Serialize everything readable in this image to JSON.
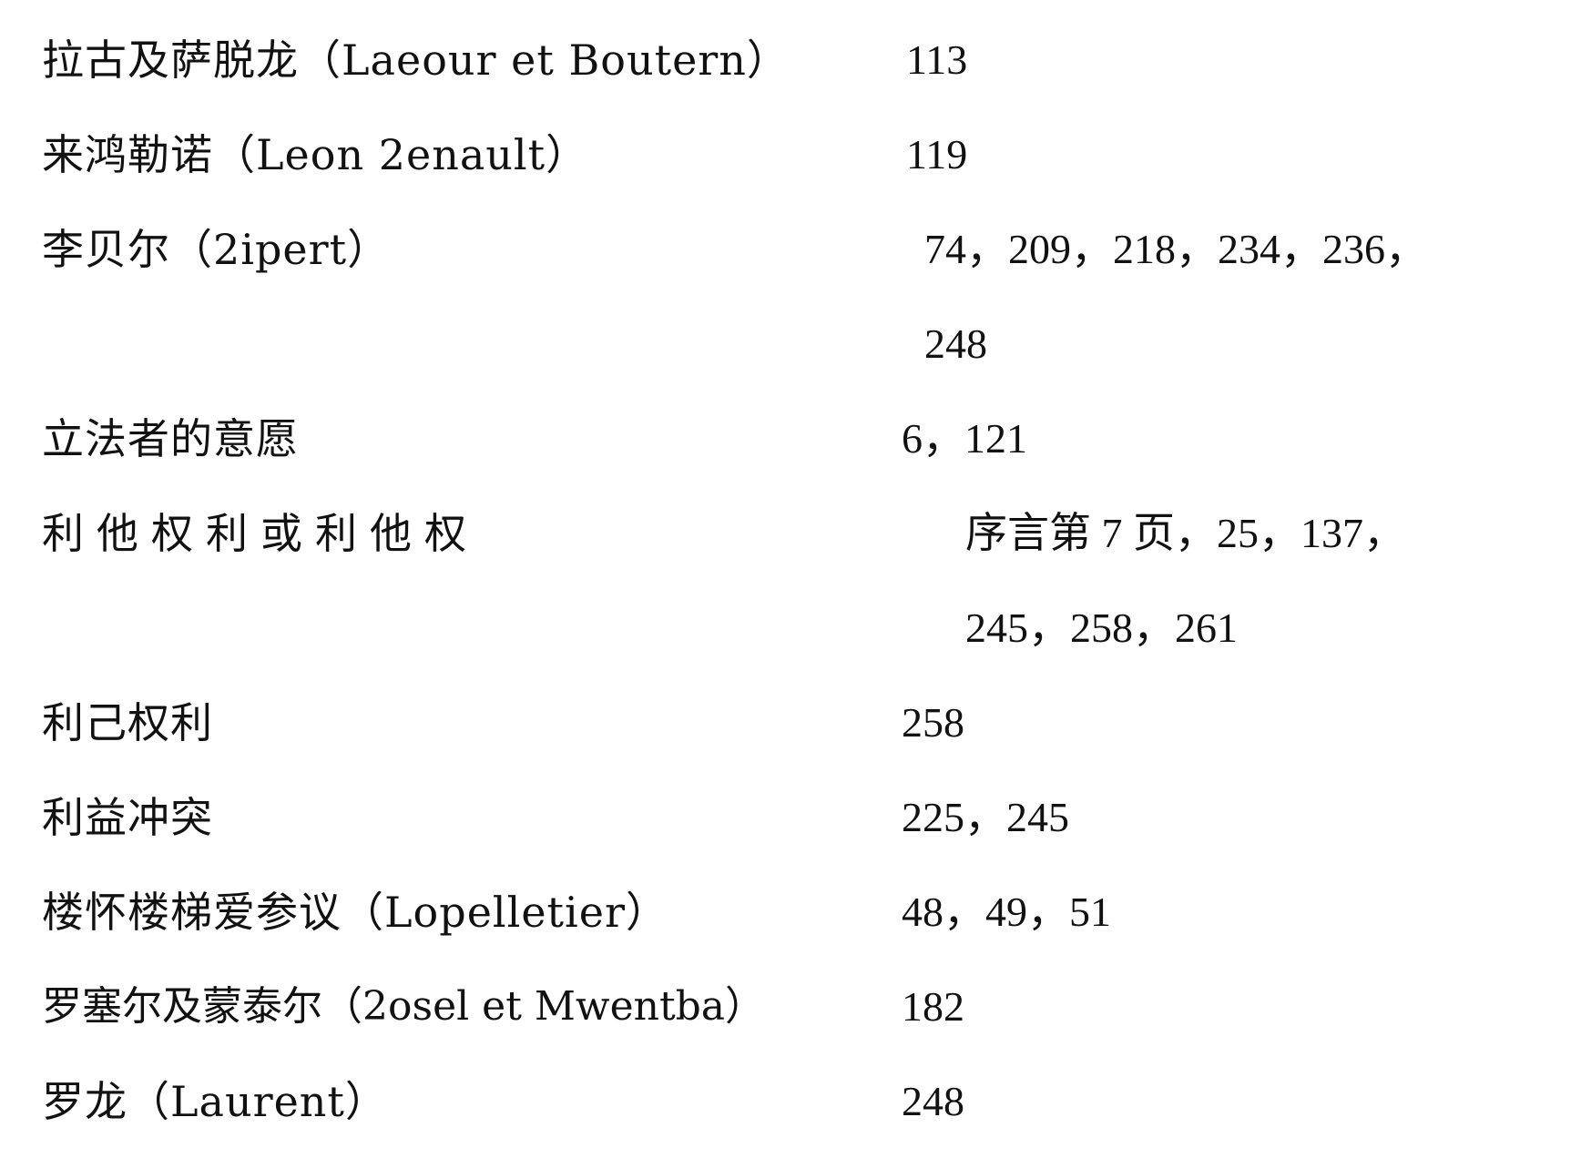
{
  "index_entries": [
    {
      "term": "拉古及萨脱龙（Laeour et Boutern）",
      "pages": "113"
    },
    {
      "term": "来鸿勒诺（Leon 2enault）",
      "pages": "119"
    },
    {
      "term": "李贝尔（2ipert）",
      "pages": "74，209，218，234，236，",
      "pages_cont": "248"
    },
    {
      "term": "立法者的意愿",
      "pages": "6，121"
    },
    {
      "term": "利他权利或利他权",
      "pages": "序言第 7 页，25，137，",
      "pages_cont": "245，258，261"
    },
    {
      "term": "利己权利",
      "pages": "258"
    },
    {
      "term": "利益冲突",
      "pages": "225，245"
    },
    {
      "term": "楼怀楼梯爱参议（Lopelletier）",
      "pages": "48，49，51"
    },
    {
      "term": "罗塞尔及蒙泰尔（2osel et Mwentba）",
      "pages": "182"
    },
    {
      "term": "罗龙（Laurent）",
      "pages": "248"
    }
  ]
}
